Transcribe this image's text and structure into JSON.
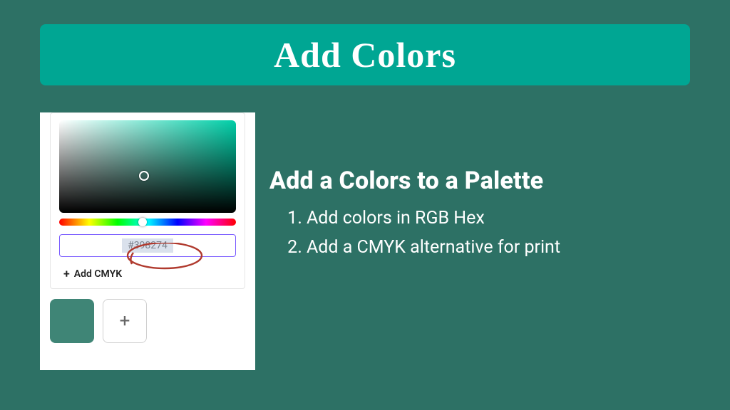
{
  "banner": {
    "title": "Add Colors"
  },
  "picker": {
    "hex_value": "#398274",
    "add_cmyk_label": "Add CMYK",
    "swatch_color": "#3f8576"
  },
  "content": {
    "heading": "Add a Colors to a Palette",
    "steps": [
      "Add colors in RGB Hex",
      "Add a CMYK alternative for print"
    ]
  }
}
